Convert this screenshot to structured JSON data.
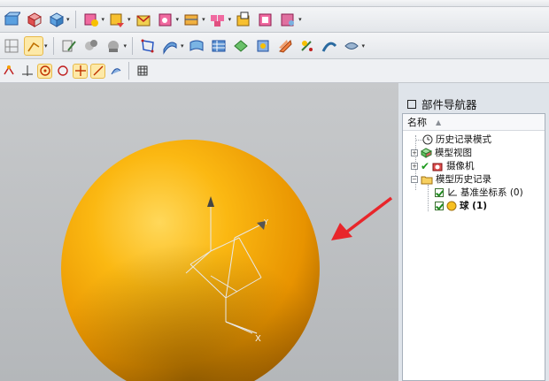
{
  "navigator": {
    "title": "部件导航器",
    "column_name": "名称",
    "items": [
      {
        "label": "历史记录模式"
      },
      {
        "label": "模型视图"
      },
      {
        "label": "摄像机"
      },
      {
        "label": "模型历史记录"
      },
      {
        "label": "基准坐标系 (0)"
      },
      {
        "label": "球 (1)"
      }
    ]
  },
  "viewport": {
    "axis_y": "Y",
    "axis_x": "X"
  },
  "colors": {
    "sphere": "#f7a800",
    "arrow": "#e8262b",
    "nav_bg": "#dfe4ea"
  }
}
